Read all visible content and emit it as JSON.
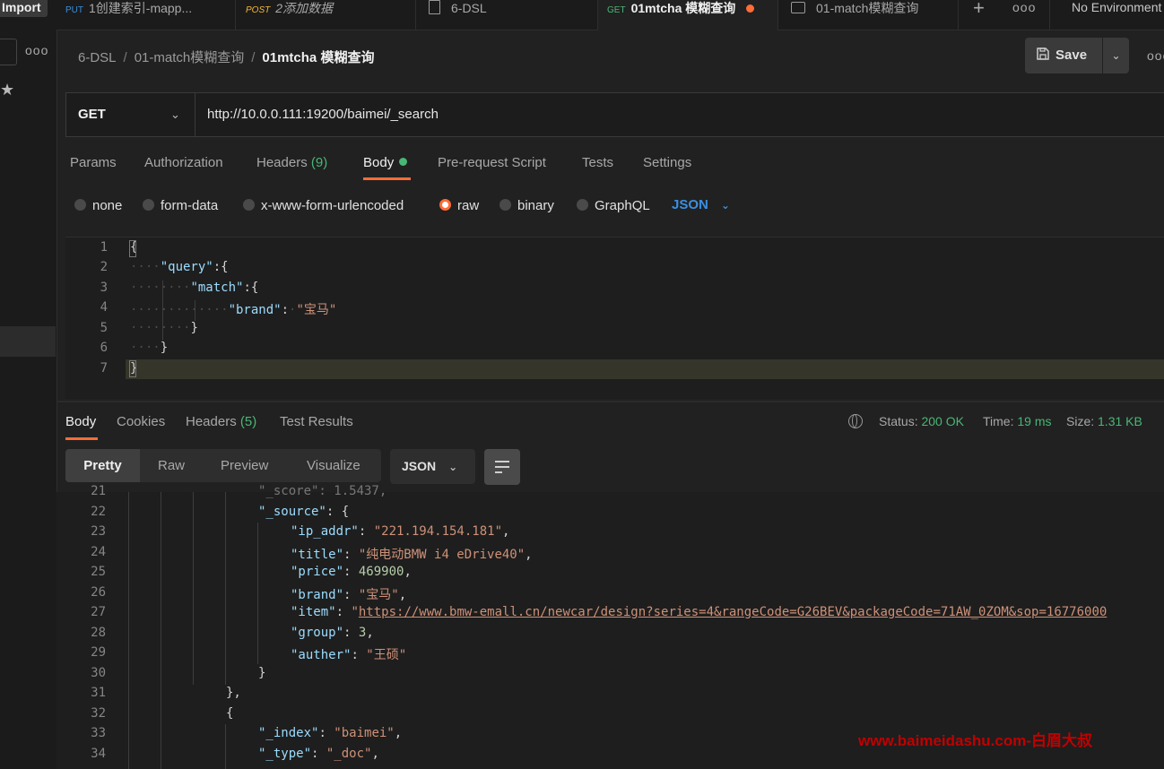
{
  "sidebar": {
    "import_label": "Import",
    "more_icon": "ooo",
    "star_icon": "★"
  },
  "tabs": [
    {
      "method": "PUT",
      "label": "1创建索引-mapp..."
    },
    {
      "method": "POST",
      "label": "2添加数据"
    },
    {
      "method": "",
      "label": "6-DSL"
    },
    {
      "method": "GET",
      "label": "01mtcha 模糊查询"
    },
    {
      "method": "",
      "label": "01-match模糊查询"
    }
  ],
  "tabbar": {
    "new_tab": "+",
    "more": "ooo",
    "environment": "No Environment"
  },
  "breadcrumb": {
    "root": "6-DSL",
    "folder": "01-match模糊查询",
    "current": "01mtcha 模糊查询",
    "sep": "/"
  },
  "header": {
    "save_label": "Save",
    "more": "ooo"
  },
  "request": {
    "method": "GET",
    "url": "http://10.0.0.111:19200/baimei/_search"
  },
  "request_tabs": {
    "params": "Params",
    "authorization": "Authorization",
    "headers": "Headers",
    "headers_count": "(9)",
    "body": "Body",
    "pre_request": "Pre-request Script",
    "tests": "Tests",
    "settings": "Settings"
  },
  "body_types": {
    "none": "none",
    "form_data": "form-data",
    "urlencoded": "x-www-form-urlencoded",
    "raw": "raw",
    "binary": "binary",
    "graphql": "GraphQL",
    "format": "JSON"
  },
  "editor_lines": [
    "1",
    "2",
    "3",
    "4",
    "5",
    "6",
    "7"
  ],
  "editor_code": {
    "l1": "{",
    "l2_key": "\"query\"",
    "l2_rest": ":{",
    "l3_key": "\"match\"",
    "l3_rest": ":{",
    "l4_key": "\"brand\"",
    "l4_colon": ":",
    "l4_val": "\"宝马\"",
    "l5": "}",
    "l6": "}",
    "l7": "}"
  },
  "response_tabs": {
    "body": "Body",
    "cookies": "Cookies",
    "headers": "Headers",
    "headers_count": "(5)",
    "test_results": "Test Results"
  },
  "status": {
    "status_label": "Status:",
    "status_value": "200 OK",
    "time_label": "Time:",
    "time_value": "19 ms",
    "size_label": "Size:",
    "size_value": "1.31 KB"
  },
  "response_view": {
    "pretty": "Pretty",
    "raw": "Raw",
    "preview": "Preview",
    "visualize": "Visualize",
    "format": "JSON"
  },
  "response_lines": [
    "21",
    "22",
    "23",
    "24",
    "25",
    "26",
    "27",
    "28",
    "29",
    "30",
    "31",
    "32",
    "33",
    "34"
  ],
  "response_code": {
    "l21": "\"_score\": 1.5437,",
    "l22_key": "\"_source\"",
    "l22_rest": ": {",
    "l23_key": "\"ip_addr\"",
    "l23_val": "\"221.194.154.181\"",
    "l24_key": "\"title\"",
    "l24_val": "\"纯电动BMW i4 eDrive40\"",
    "l25_key": "\"price\"",
    "l25_val": "469900",
    "l26_key": "\"brand\"",
    "l26_val": "\"宝马\"",
    "l27_key": "\"item\"",
    "l27_val": "https://www.bmw-emall.cn/newcar/design?series=4&rangeCode=G26BEV&packageCode=71AW_0ZOM&sop=16776000",
    "l28_key": "\"group\"",
    "l28_val": "3",
    "l29_key": "\"auther\"",
    "l29_val": "\"王硕\"",
    "l30": "}",
    "l31": "},",
    "l32": "{",
    "l33_key": "\"_index\"",
    "l33_val": "\"baimei\"",
    "l34_key": "\"_type\"",
    "l34_val": "\"_doc\""
  },
  "watermark": "www.baimeidashu.com-白眉大叔",
  "colors": {
    "accent": "#ff6c37",
    "success": "#49b675",
    "link": "#3b8fe0",
    "json_key": "#9cdcfe",
    "json_string": "#ce9178",
    "json_number": "#b5cea8"
  }
}
